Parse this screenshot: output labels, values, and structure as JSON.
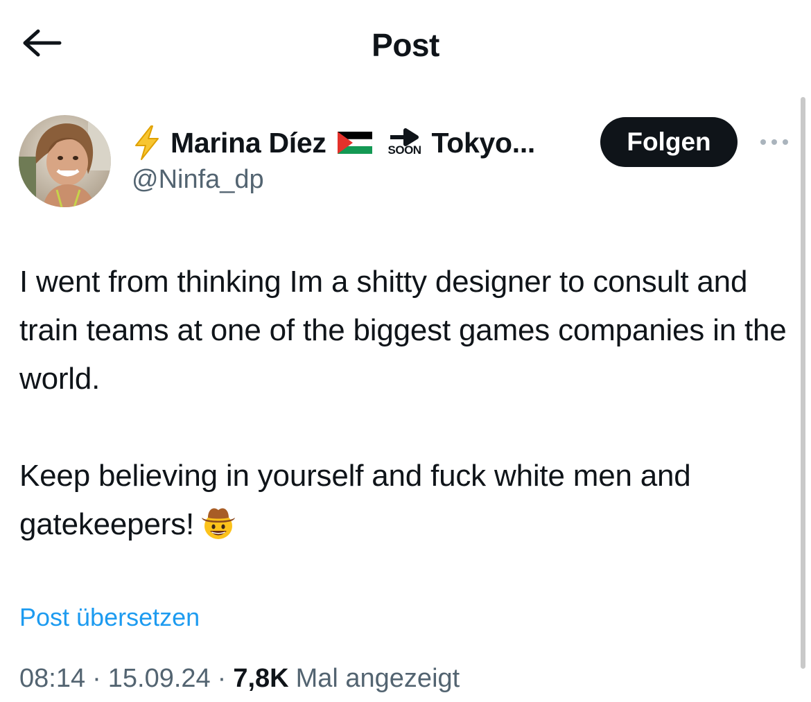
{
  "header": {
    "title": "Post",
    "back_icon": "arrow-left-icon"
  },
  "author": {
    "name_prefix_icon": "high-voltage-emoji",
    "display_name": "Marina Díez",
    "flag_icon": "palestine-flag-emoji",
    "soon_label": "SOON",
    "name_suffix": "Tokyo...",
    "handle": "@Ninfa_dp"
  },
  "actions": {
    "follow_label": "Folgen",
    "more_icon": "more-horizontal-icon"
  },
  "tweet": {
    "paragraph_1": "I went from thinking Im a shitty designer to consult and train teams at one of the biggest games companies in the world.",
    "paragraph_2": "Keep believing in yourself and fuck white men and gatekeepers!",
    "emoji": "cowboy-hat-face-emoji",
    "translate_label": "Post übersetzen"
  },
  "meta": {
    "time": "08:14",
    "date": "15.09.24",
    "views_count": "7,8K",
    "views_label": "Mal angezeigt",
    "separator": "·"
  },
  "colors": {
    "text_primary": "#0f1419",
    "text_secondary": "#536471",
    "link": "#1d9bf0",
    "button_bg": "#0f1419"
  }
}
